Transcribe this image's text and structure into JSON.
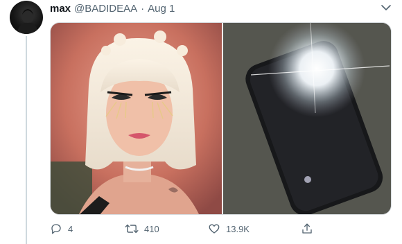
{
  "tweet": {
    "display_name": "max",
    "handle": "@BADIDEAA",
    "separator": "·",
    "date": "Aug 1",
    "media": {
      "left_image": "photo of a person with platinum blonde bob hair and dramatic eyelashes",
      "right_image": "photo of a phone with a bright flash light"
    },
    "actions": {
      "replies": "4",
      "retweets": "410",
      "likes": "13.9K"
    }
  }
}
